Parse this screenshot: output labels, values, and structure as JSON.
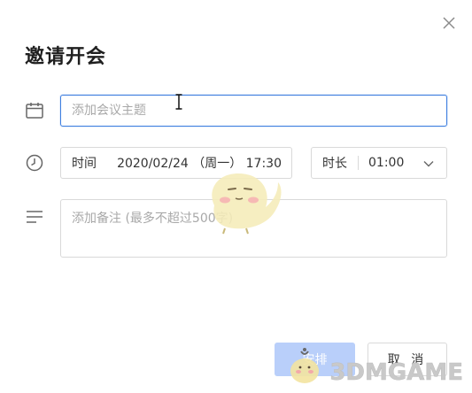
{
  "dialog": {
    "title": "邀请开会",
    "close_icon": "close-icon"
  },
  "subject": {
    "icon": "calendar-icon",
    "placeholder": "添加会议主题",
    "value": ""
  },
  "time": {
    "icon": "clock-icon",
    "label": "时间",
    "value": "2020/02/24 （周一） 17:30"
  },
  "duration": {
    "label": "时长",
    "value": "01:00",
    "icon": "chevron-down-icon"
  },
  "notes": {
    "icon": "notes-icon",
    "placeholder": "添加备注 (最多不超过500字)",
    "value": ""
  },
  "footer": {
    "primary_label": "安排",
    "cancel_label": "取 消"
  },
  "watermark": {
    "text": "3DMGAME"
  },
  "colors": {
    "accent": "#3f7fe0",
    "primary_disabled": "#b9cffa",
    "border": "#d9d9d9",
    "placeholder": "#a8a8a8"
  }
}
